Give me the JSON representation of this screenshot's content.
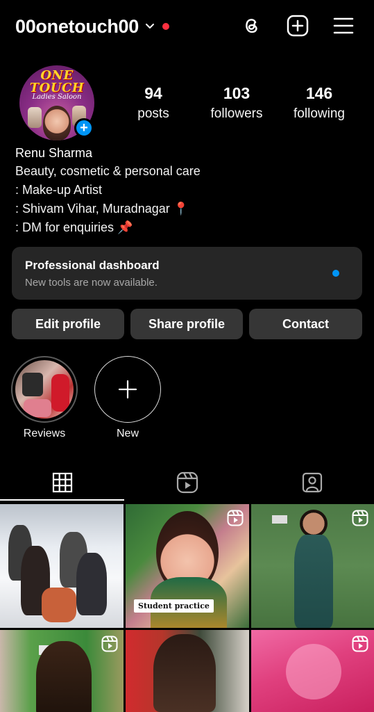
{
  "header": {
    "username": "00onetouch00"
  },
  "profile": {
    "avatar_text_1": "ONE",
    "avatar_text_2": "TOUCH",
    "avatar_text_3": "Ladies Saloon",
    "stats": [
      {
        "value": "94",
        "label": "posts"
      },
      {
        "value": "103",
        "label": "followers"
      },
      {
        "value": "146",
        "label": "following"
      }
    ],
    "name": "Renu Sharma",
    "bio_lines": [
      "Beauty, cosmetic & personal care",
      ": Make-up Artist",
      ": Shivam Vihar, Muradnagar 📍",
      ": DM for enquiries 📌"
    ]
  },
  "dashboard": {
    "title": "Professional dashboard",
    "subtitle": "New tools are now available."
  },
  "buttons": {
    "edit": "Edit profile",
    "share": "Share profile",
    "contact": "Contact"
  },
  "highlights": [
    {
      "label": "Reviews"
    },
    {
      "label": "New"
    }
  ],
  "posts": {
    "caption_2": "Student practice"
  },
  "colors": {
    "accent_blue": "#0095f6",
    "notification_red": "#ff3040",
    "card_bg": "#262626",
    "button_bg": "#363636"
  }
}
